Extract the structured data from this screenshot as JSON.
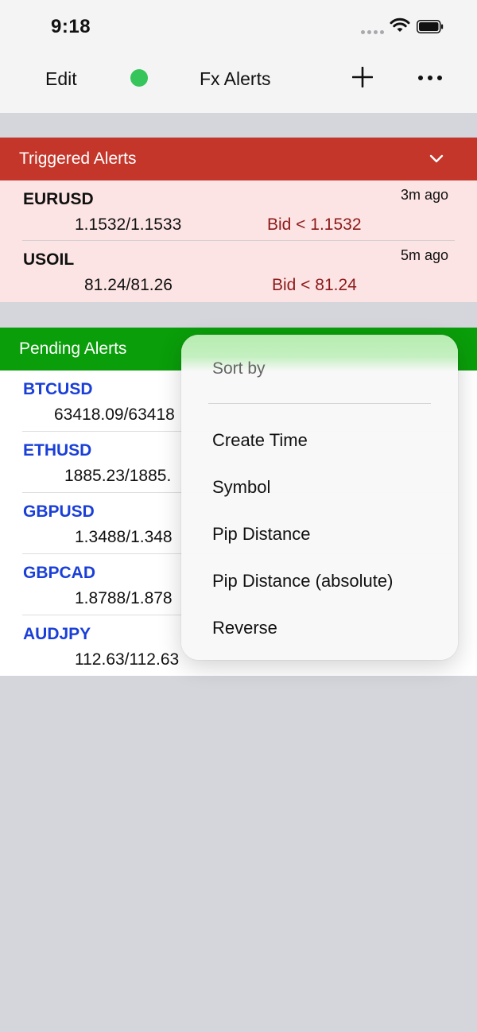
{
  "status": {
    "time": "9:18"
  },
  "nav": {
    "edit": "Edit",
    "title": "Fx Alerts"
  },
  "triggered": {
    "title": "Triggered Alerts",
    "items": [
      {
        "symbol": "EURUSD",
        "prices": "1.1532/1.1533",
        "condition": "Bid < 1.1532",
        "age": "3m ago"
      },
      {
        "symbol": "USOIL",
        "prices": "81.24/81.26",
        "condition": "Bid < 81.24",
        "age": "5m ago"
      }
    ]
  },
  "pending": {
    "title": "Pending Alerts",
    "items": [
      {
        "symbol": "BTCUSD",
        "prices": "63418.09/63418"
      },
      {
        "symbol": "ETHUSD",
        "prices": "1885.23/1885."
      },
      {
        "symbol": "GBPUSD",
        "prices": "1.3488/1.348"
      },
      {
        "symbol": "GBPCAD",
        "prices": "1.8788/1.878"
      },
      {
        "symbol": "AUDJPY",
        "prices": "112.63/112.63"
      }
    ]
  },
  "menu": {
    "header": "Sort by",
    "items": [
      "Create Time",
      "Symbol",
      "Pip Distance",
      "Pip Distance (absolute)",
      "Reverse"
    ]
  },
  "colors": {
    "triggered": "#c4362a",
    "pending": "#0a9e0a",
    "symbol_blue": "#1a3fd8",
    "condition_red": "#8c1a1a",
    "connected_dot": "#35c55a"
  }
}
